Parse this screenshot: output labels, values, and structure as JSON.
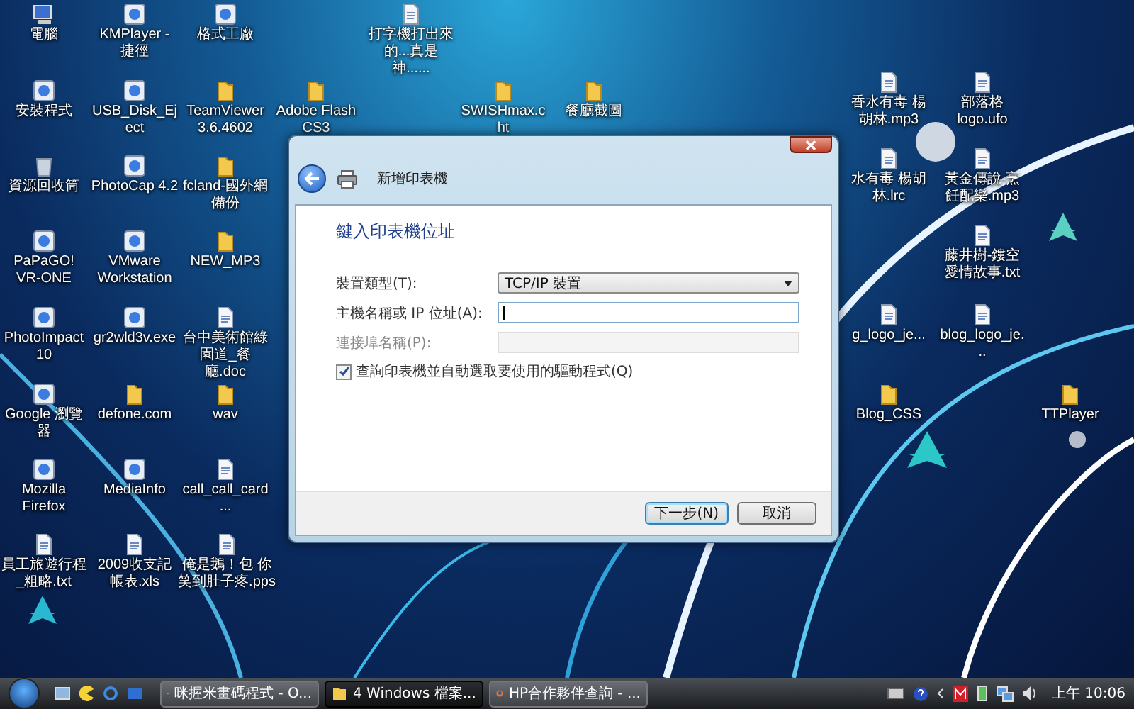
{
  "desktop_icons": [
    {
      "label": "電腦",
      "kind": "computer"
    },
    {
      "label": "安裝程式",
      "kind": "app"
    },
    {
      "label": "資源回收筒",
      "kind": "recycle"
    },
    {
      "label": "PaPaGO! VR-ONE",
      "kind": "app"
    },
    {
      "label": "PhotoImpact 10",
      "kind": "app"
    },
    {
      "label": "Google 瀏覽器",
      "kind": "app"
    },
    {
      "label": "Mozilla Firefox",
      "kind": "app"
    },
    {
      "label": "員工旅遊行程_粗略.txt",
      "kind": "file"
    },
    {
      "label": "KMPlayer - 捷徑",
      "kind": "app"
    },
    {
      "label": "USB_Disk_Eject",
      "kind": "app"
    },
    {
      "label": "PhotoCap 4.2",
      "kind": "app"
    },
    {
      "label": "VMware Workstation",
      "kind": "app"
    },
    {
      "label": "gr2wld3v.exe",
      "kind": "app"
    },
    {
      "label": "defone.com",
      "kind": "folder"
    },
    {
      "label": "MediaInfo",
      "kind": "app"
    },
    {
      "label": "2009收支記帳表.xls",
      "kind": "file"
    },
    {
      "label": "格式工廠",
      "kind": "app"
    },
    {
      "label": "TeamViewer 3.6.4602",
      "kind": "folder"
    },
    {
      "label": "fcland-國外網備份",
      "kind": "folder"
    },
    {
      "label": "NEW_MP3",
      "kind": "folder"
    },
    {
      "label": "台中美術館綠園道_餐廳.doc",
      "kind": "file"
    },
    {
      "label": "wav",
      "kind": "folder"
    },
    {
      "label": "call_call_card...",
      "kind": "file"
    },
    {
      "label": "俺是鵝！包 你笑到肚子疼.pps",
      "kind": "file"
    },
    {
      "label": "Adobe Flash CS3",
      "kind": "folder"
    },
    {
      "label": "打字機打出來的...真是神......",
      "kind": "file"
    },
    {
      "label": "SWISHmax.cht",
      "kind": "folder"
    },
    {
      "label": "餐廳截圖",
      "kind": "folder"
    },
    {
      "label": "香水有毒 楊胡林.mp3",
      "kind": "file"
    },
    {
      "label": "部落格logo.ufo",
      "kind": "file"
    },
    {
      "label": "水有毒 楊胡林.lrc",
      "kind": "file"
    },
    {
      "label": "黃金傳說-烹飪配樂.mp3",
      "kind": "file"
    },
    {
      "label": "藤井樹-鏤空愛情故事.txt",
      "kind": "file"
    },
    {
      "label": "g_logo_je...",
      "kind": "file"
    },
    {
      "label": "blog_logo_je...",
      "kind": "file"
    },
    {
      "label": "Blog_CSS",
      "kind": "folder"
    },
    {
      "label": "TTPlayer",
      "kind": "folder"
    }
  ],
  "dialog": {
    "title": "新增印表機",
    "heading": "鍵入印表機位址",
    "fields": [
      {
        "kind": "dropdown",
        "label": "裝置類型(T):",
        "value": "TCP/IP 裝置",
        "disabled": false,
        "focused": false
      },
      {
        "kind": "text",
        "label": "主機名稱或 IP 位址(A):",
        "disabled": false,
        "focused": true
      },
      {
        "kind": "text",
        "label": "連接埠名稱(P):",
        "disabled": true,
        "focused": false
      }
    ],
    "checkbox": {
      "label": "查詢印表機並自動選取要使用的驅動程式(Q)",
      "checked": true
    },
    "buttons": [
      {
        "label": "下一步(N)",
        "default": true
      },
      {
        "label": "取消",
        "default": false
      }
    ]
  },
  "taskbar": {
    "tasks": [
      {
        "label": "咪握米畫碼程式 - O...",
        "kind": "app",
        "selected": false
      },
      {
        "label": "4 Windows 檔案...",
        "kind": "folder",
        "selected": true
      },
      {
        "label": "HP合作夥伴查詢 - ...",
        "kind": "browser",
        "selected": false
      }
    ],
    "clock": "上午 10:06"
  }
}
